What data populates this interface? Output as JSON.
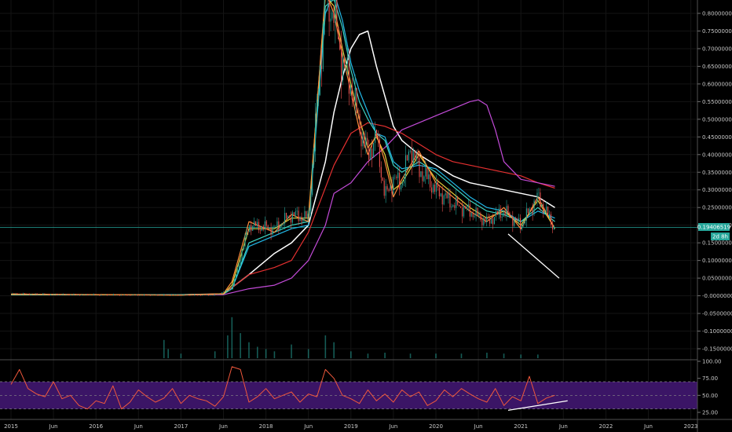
{
  "chart_data": [
    {
      "type": "candlestick",
      "y_axis_ticks": [
        "0.80000000",
        "0.75000000",
        "0.70000000",
        "0.65000000",
        "0.60000000",
        "0.55000000",
        "0.50000000",
        "0.45000000",
        "0.40000000",
        "0.35000000",
        "0.30000000",
        "0.25000000",
        "0.20000000",
        "0.15000000",
        "0.10000000",
        "0.05000000",
        "-0.00000000",
        "-0.05000000",
        "-0.10000000",
        "-0.15000000"
      ],
      "ylim": [
        -0.165,
        0.815
      ],
      "x_axis_ticks": [
        "2015",
        "Jun",
        "2016",
        "Jun",
        "2017",
        "Jun",
        "2018",
        "Jun",
        "2019",
        "Jun",
        "2020",
        "Jun",
        "2021",
        "Jun",
        "2022",
        "Jun",
        "2023"
      ],
      "last_price": "0.19406519",
      "last_price_value": 0.194,
      "countdown": "2d 8h",
      "x": [
        0,
        5,
        10,
        15,
        20,
        24,
        26,
        28,
        31,
        33,
        35,
        37,
        38,
        39,
        40,
        41,
        42,
        43,
        44,
        45,
        46,
        47,
        48,
        50,
        52,
        54,
        56,
        58,
        60,
        62,
        64
      ],
      "close": [
        0.006,
        0.004,
        0.003,
        0.002,
        0.002,
        0.002,
        0.02,
        0.2,
        0.19,
        0.23,
        0.22,
        0.85,
        0.8,
        0.66,
        0.6,
        0.48,
        0.4,
        0.45,
        0.28,
        0.33,
        0.32,
        0.42,
        0.36,
        0.3,
        0.26,
        0.24,
        0.21,
        0.24,
        0.2,
        0.28,
        0.19
      ],
      "series": [
        {
          "name": "",
          "color": "#ffffff",
          "x": [
            0,
            20,
            25,
            28,
            31,
            33,
            35,
            37,
            38,
            39,
            40,
            41,
            42,
            43,
            45,
            46,
            48,
            50,
            52,
            54,
            56,
            58,
            60,
            62,
            64
          ],
          "values": [
            0.003,
            0.003,
            0.005,
            0.06,
            0.12,
            0.15,
            0.2,
            0.38,
            0.52,
            0.62,
            0.7,
            0.74,
            0.75,
            0.65,
            0.48,
            0.44,
            0.4,
            0.37,
            0.34,
            0.32,
            0.31,
            0.3,
            0.29,
            0.28,
            0.25
          ]
        },
        {
          "name": "",
          "color": "#e53030",
          "x": [
            0,
            20,
            25,
            28,
            31,
            33,
            35,
            38,
            40,
            42,
            44,
            46,
            48,
            50,
            52,
            54,
            56,
            58,
            60,
            62,
            64
          ],
          "values": [
            0.003,
            0.003,
            0.005,
            0.06,
            0.08,
            0.1,
            0.18,
            0.37,
            0.46,
            0.49,
            0.48,
            0.46,
            0.43,
            0.4,
            0.38,
            0.37,
            0.36,
            0.35,
            0.34,
            0.32,
            0.305
          ]
        },
        {
          "name": "",
          "color": "#c34bd8",
          "x": [
            0,
            20,
            25,
            28,
            31,
            33,
            35,
            37,
            38,
            40,
            42,
            44,
            46,
            48,
            50,
            52,
            54,
            55,
            56,
            57,
            58,
            60,
            62,
            64
          ],
          "values": [
            0.003,
            0.003,
            0.003,
            0.02,
            0.03,
            0.05,
            0.1,
            0.2,
            0.29,
            0.32,
            0.38,
            0.42,
            0.47,
            0.49,
            0.51,
            0.53,
            0.55,
            0.555,
            0.54,
            0.47,
            0.38,
            0.33,
            0.32,
            0.31
          ]
        },
        {
          "name": "",
          "color": "#22b8e8",
          "x": [
            0,
            20,
            25,
            26,
            28,
            31,
            33,
            35,
            37,
            38,
            39,
            40,
            41,
            42,
            43,
            44,
            45,
            46,
            48,
            50,
            52,
            54,
            56,
            58,
            60,
            62,
            64
          ],
          "values": [
            0.003,
            0.003,
            0.005,
            0.02,
            0.14,
            0.17,
            0.19,
            0.2,
            0.8,
            0.86,
            0.78,
            0.66,
            0.58,
            0.52,
            0.46,
            0.45,
            0.38,
            0.36,
            0.37,
            0.36,
            0.32,
            0.28,
            0.25,
            0.24,
            0.21,
            0.24,
            0.22
          ]
        },
        {
          "name": "",
          "color": "#3fd5c2",
          "x": [
            0,
            20,
            25,
            26,
            28,
            31,
            33,
            35,
            37,
            38,
            39,
            40,
            41,
            42,
            43,
            44,
            45,
            46,
            48,
            50,
            52,
            54,
            56,
            58,
            60,
            62,
            64
          ],
          "values": [
            0.003,
            0.003,
            0.005,
            0.02,
            0.15,
            0.18,
            0.2,
            0.21,
            0.82,
            0.84,
            0.76,
            0.64,
            0.55,
            0.5,
            0.46,
            0.44,
            0.37,
            0.35,
            0.38,
            0.35,
            0.31,
            0.27,
            0.24,
            0.23,
            0.21,
            0.25,
            0.21
          ]
        },
        {
          "name": "",
          "color": "#e8d23a",
          "x": [
            0,
            20,
            25,
            26,
            28,
            31,
            33,
            35,
            37,
            38,
            39,
            40,
            41,
            42,
            43,
            44,
            45,
            46,
            48,
            50,
            52,
            54,
            56,
            58,
            60,
            62,
            64
          ],
          "values": [
            0.004,
            0.002,
            0.005,
            0.03,
            0.19,
            0.19,
            0.22,
            0.22,
            0.85,
            0.82,
            0.7,
            0.6,
            0.5,
            0.42,
            0.45,
            0.4,
            0.3,
            0.32,
            0.4,
            0.33,
            0.29,
            0.25,
            0.22,
            0.24,
            0.2,
            0.27,
            0.19
          ]
        },
        {
          "name": "",
          "color": "#ff8c3a",
          "x": [
            0,
            20,
            25,
            26,
            28,
            31,
            33,
            35,
            37,
            38,
            39,
            40,
            41,
            42,
            43,
            44,
            45,
            46,
            48,
            50,
            52,
            54,
            56,
            58,
            60,
            62,
            64
          ],
          "values": [
            0.005,
            0.002,
            0.006,
            0.04,
            0.21,
            0.18,
            0.23,
            0.21,
            0.86,
            0.8,
            0.68,
            0.58,
            0.47,
            0.4,
            0.46,
            0.38,
            0.28,
            0.33,
            0.41,
            0.32,
            0.28,
            0.24,
            0.21,
            0.25,
            0.19,
            0.28,
            0.19
          ]
        }
      ],
      "trendlines": [
        {
          "color": "#ffffff",
          "x": [
            58.5,
            64.5
          ],
          "values": [
            0.175,
            0.05
          ]
        }
      ],
      "last_price_line_color": "#26a69a",
      "volume": [
        {
          "x": 26,
          "v": 0.9
        },
        {
          "x": 25.5,
          "v": 0.5
        },
        {
          "x": 27,
          "v": 0.55
        },
        {
          "x": 28,
          "v": 0.35
        },
        {
          "x": 29,
          "v": 0.25
        },
        {
          "x": 30,
          "v": 0.2
        },
        {
          "x": 31,
          "v": 0.15
        },
        {
          "x": 33,
          "v": 0.3
        },
        {
          "x": 35,
          "v": 0.2
        },
        {
          "x": 37,
          "v": 0.5
        },
        {
          "x": 38,
          "v": 0.35
        },
        {
          "x": 18,
          "v": 0.4
        },
        {
          "x": 18.5,
          "v": 0.2
        },
        {
          "x": 20,
          "v": 0.1
        },
        {
          "x": 24,
          "v": 0.15
        },
        {
          "x": 40,
          "v": 0.15
        },
        {
          "x": 42,
          "v": 0.1
        },
        {
          "x": 44,
          "v": 0.12
        },
        {
          "x": 47,
          "v": 0.1
        },
        {
          "x": 50,
          "v": 0.1
        },
        {
          "x": 53,
          "v": 0.1
        },
        {
          "x": 56,
          "v": 0.12
        },
        {
          "x": 58,
          "v": 0.1
        },
        {
          "x": 60,
          "v": 0.08
        },
        {
          "x": 62,
          "v": 0.08
        }
      ]
    },
    {
      "type": "line",
      "indicator": "rsi",
      "y_axis_ticks": [
        "100.00",
        "75.00",
        "50.00",
        "25.00"
      ],
      "ylim": [
        20,
        102
      ],
      "band": [
        30,
        70
      ],
      "band_color": "#3b1566",
      "line_color": "#f0583c",
      "x": [
        0,
        1,
        2,
        3,
        4,
        5,
        6,
        7,
        8,
        9,
        10,
        11,
        12,
        13,
        14,
        15,
        16,
        17,
        18,
        19,
        20,
        21,
        22,
        23,
        24,
        25,
        26,
        27,
        28,
        29,
        30,
        31,
        32,
        33,
        34,
        35,
        36,
        37,
        38,
        39,
        40,
        41,
        42,
        43,
        44,
        45,
        46,
        47,
        48,
        49,
        50,
        51,
        52,
        53,
        54,
        55,
        56,
        57,
        58,
        59,
        60,
        61,
        62,
        63,
        64
      ],
      "values": [
        66,
        88,
        60,
        52,
        48,
        70,
        45,
        50,
        35,
        30,
        42,
        38,
        64,
        30,
        40,
        58,
        48,
        40,
        46,
        60,
        38,
        50,
        45,
        42,
        34,
        48,
        92,
        88,
        40,
        48,
        60,
        45,
        50,
        55,
        40,
        52,
        48,
        88,
        75,
        50,
        45,
        38,
        58,
        42,
        52,
        40,
        58,
        48,
        55,
        35,
        42,
        58,
        48,
        60,
        52,
        45,
        40,
        60,
        35,
        48,
        42,
        78,
        38,
        46,
        50
      ],
      "trendlines": [
        {
          "color": "#ffffff",
          "x": [
            58.5,
            65.5
          ],
          "values": [
            28,
            42
          ]
        }
      ]
    }
  ]
}
